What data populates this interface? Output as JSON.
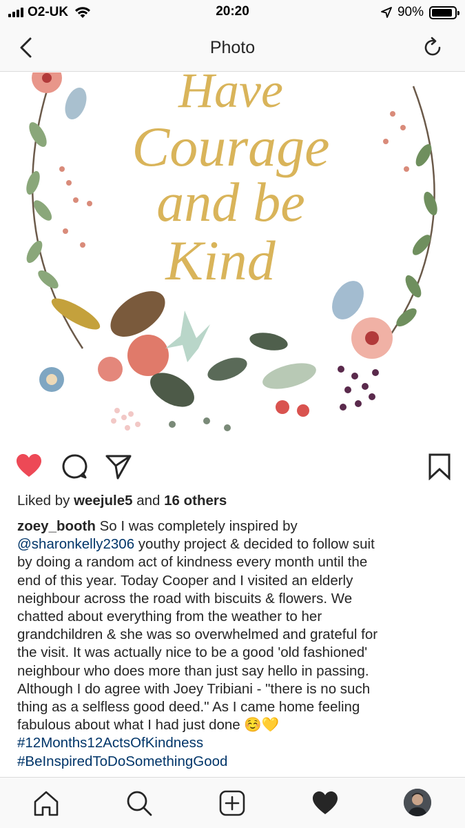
{
  "status_bar": {
    "carrier": "O2-UK",
    "time": "20:20",
    "battery_percent": "90%",
    "battery_level": 0.9
  },
  "nav": {
    "title": "Photo",
    "back_icon": "chevron-left-icon",
    "refresh_icon": "refresh-icon"
  },
  "photo": {
    "text_lines": [
      "Have",
      "Courage",
      "and be",
      "Kind"
    ],
    "colors": {
      "gold": "#d9b45a",
      "coral": "#e8968a",
      "sage": "#9bb79a",
      "olive": "#7a8a4c",
      "purple": "#5a2a4c"
    }
  },
  "actions": {
    "like_icon": "heart-filled-icon",
    "comment_icon": "comment-icon",
    "share_icon": "paper-plane-icon",
    "save_icon": "bookmark-icon",
    "like_color": "#ed4956"
  },
  "likes": {
    "prefix": "Liked by ",
    "user": "weejule5",
    "middle": " and ",
    "others": "16 others"
  },
  "caption": {
    "username": "zoey_booth",
    "line1_text": " So I was completely inspired by",
    "mention": "@sharonkelly2306",
    "line2_text": " youthy project & decided to follow suit",
    "lines": [
      "by doing a random act of kindness every month until the",
      "end of this year. Today Cooper and I visited an elderly",
      "neighbour across the road with biscuits & flowers. We",
      "chatted about everything from the weather to her",
      "grandchildren & she was so overwhelmed and grateful for",
      "the visit. It was actually nice to be a good 'old fashioned'",
      "neighbour who does more than just say hello in passing.",
      "Although I do agree with Joey Tribiani - \"there is no such",
      "thing as a selfless good deed.\" As I came home feeling"
    ],
    "last_line": "fabulous about what I had just done ☺️💛",
    "hashtags": [
      "#12Months12ActsOfKindness",
      "#BeInspiredToDoSomethingGood"
    ],
    "link_color": "#003569"
  },
  "tab_bar": {
    "items": [
      "home-icon",
      "search-icon",
      "new-post-icon",
      "activity-heart-icon",
      "profile-avatar"
    ]
  }
}
